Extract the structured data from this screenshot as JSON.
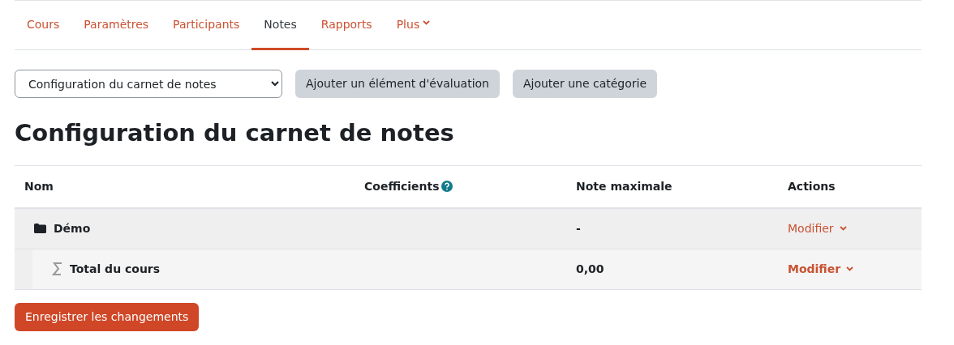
{
  "tabs": [
    {
      "label": "Cours",
      "selected": false
    },
    {
      "label": "Paramètres",
      "selected": false
    },
    {
      "label": "Participants",
      "selected": false
    },
    {
      "label": "Notes",
      "selected": true
    },
    {
      "label": "Rapports",
      "selected": false
    },
    {
      "label": "Plus",
      "selected": false,
      "dropdown": true
    }
  ],
  "toolbar": {
    "select": {
      "value": "Configuration du carnet de notes"
    },
    "buttons": [
      "Ajouter un élément d'évaluation",
      "Ajouter une catégorie"
    ]
  },
  "heading": "Configuration du carnet de notes",
  "table": {
    "columns": [
      {
        "label": "Nom",
        "help": false
      },
      {
        "label": "Coefficients",
        "help": true
      },
      {
        "label": "Note maximale",
        "help": false
      },
      {
        "label": "Actions",
        "help": false
      }
    ],
    "rows": [
      {
        "kind": "category",
        "name": "Démo",
        "max": "-",
        "action": "Modifier",
        "children": [
          {
            "kind": "total",
            "name": "Total du cours",
            "max": "0,00",
            "action": "Modifier"
          }
        ]
      }
    ]
  },
  "save_button": "Enregistrer les changements"
}
